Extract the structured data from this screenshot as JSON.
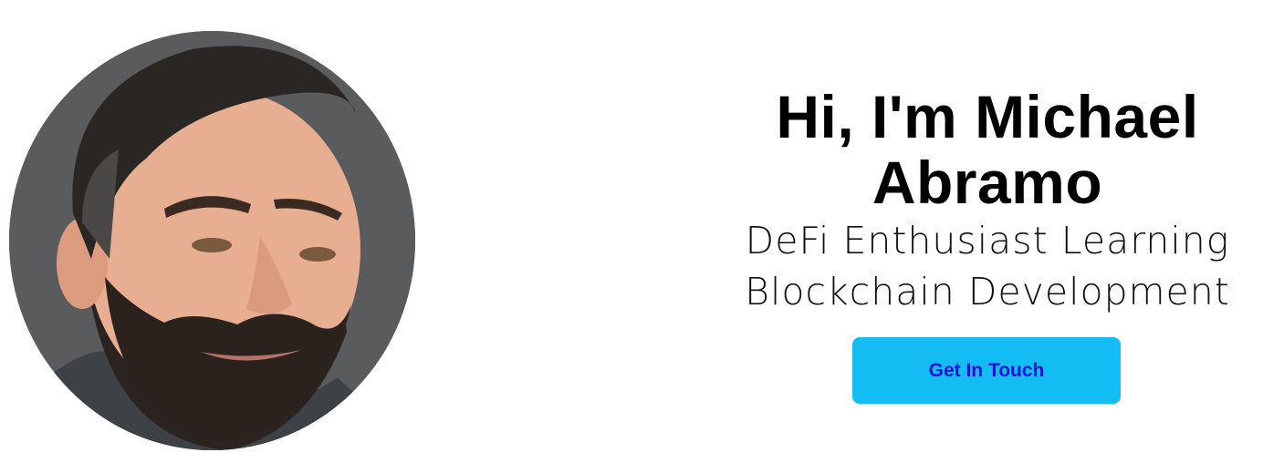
{
  "hero": {
    "name": "Hi, I'm Michael Abramo",
    "tagline": "DeFi Enthusiast Learning Blockchain Development",
    "cta_label": "Get In Touch",
    "photo_description_icon": "profile-photo",
    "colors": {
      "button_bg": "#13bdf4",
      "button_text": "#1a12d6",
      "heading": "#000000",
      "photo_bg": "#5b5c5d"
    }
  }
}
